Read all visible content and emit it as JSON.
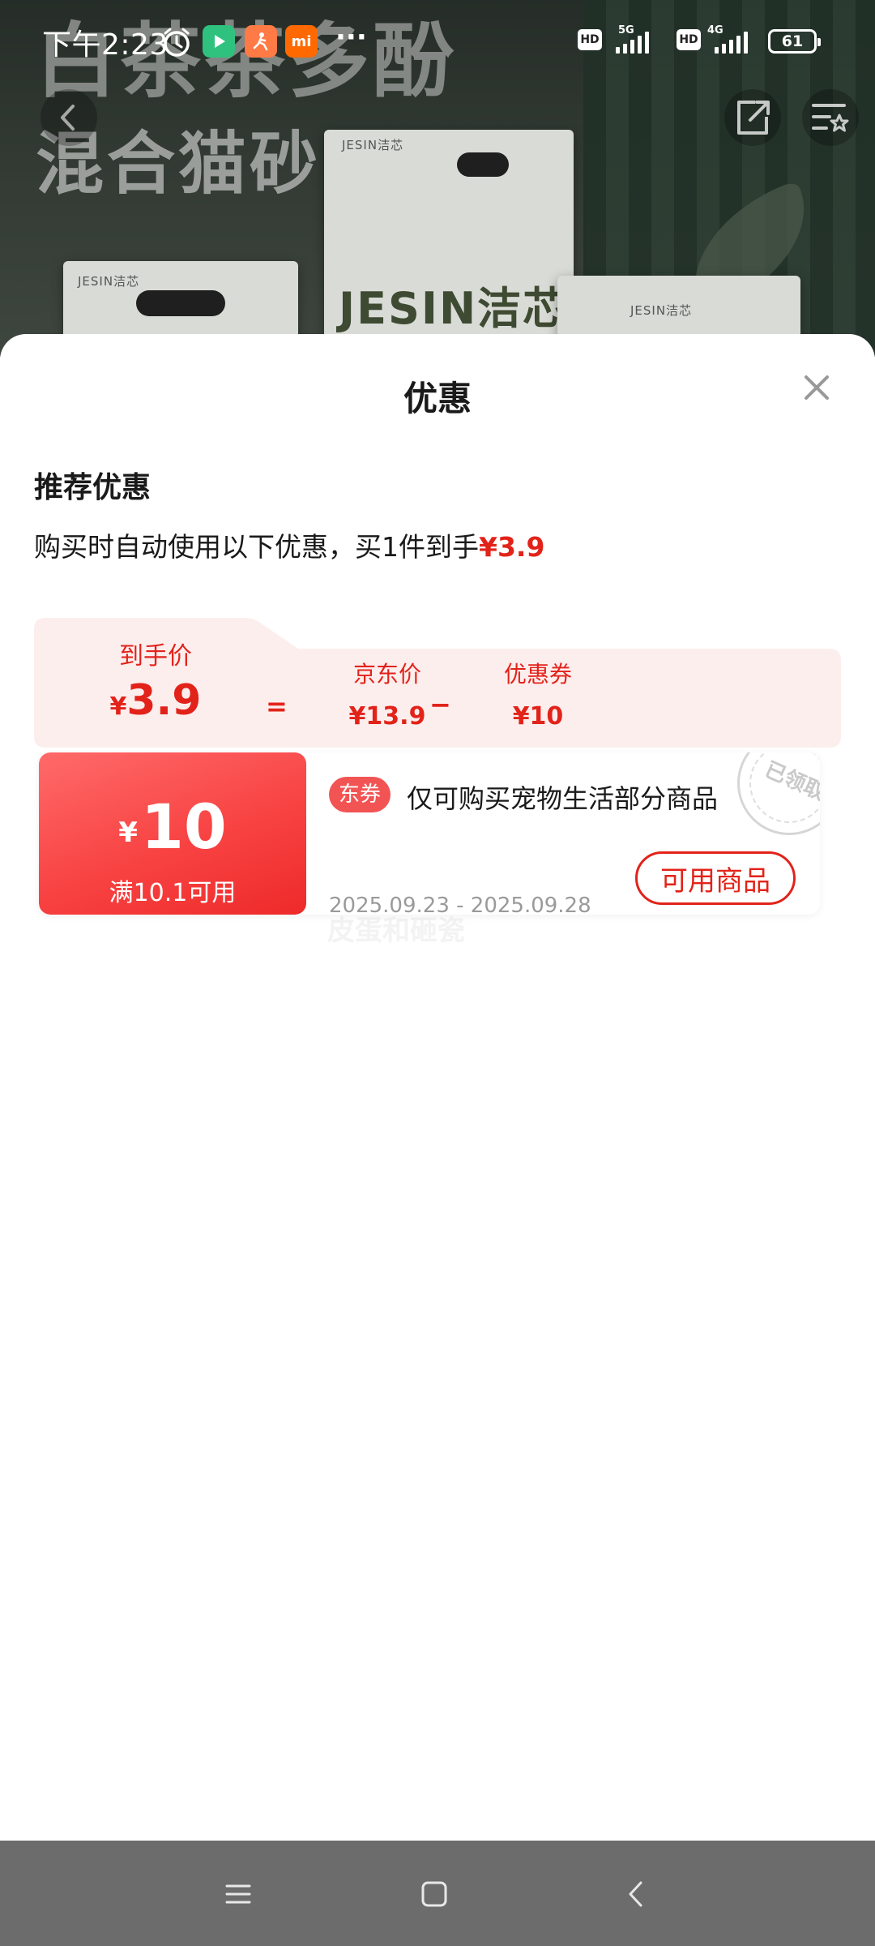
{
  "status_bar": {
    "time": "下午2:23",
    "network_1": "5G",
    "network_2": "4G",
    "hd_label": "HD",
    "battery": "61",
    "mi_label": "mi",
    "more_label": "···"
  },
  "banner": {
    "headline": "白茶茶多酚",
    "subline": "混合猫砂",
    "brand_small": "JESIN洁芯",
    "brand_big": "JESIN洁芯"
  },
  "sheet": {
    "title": "优惠",
    "section_heading": "推荐优惠",
    "desc_prefix": "购买时自动使用以下优惠，买1件到手",
    "desc_price": "¥3.9"
  },
  "price_breakdown": {
    "final_label": "到手价",
    "final_currency": "¥",
    "final_value": "3.9",
    "eq": "=",
    "jd_label": "京东价",
    "jd_value": "¥13.9",
    "minus": "−",
    "coupon_label": "优惠券",
    "coupon_value": "¥10"
  },
  "coupon": {
    "currency": "¥",
    "amount": "10",
    "condition": "满10.1可用",
    "tag": "东券",
    "description": "仅可购买宠物生活部分商品",
    "date_range": "2025.09.23 - 2025.09.28",
    "action": "可用商品",
    "stamp": "已领取"
  },
  "background_ghost_text": "皮蛋和砸瓷",
  "colors": {
    "accent_red": "#e2231a",
    "coupon_gradient_start": "#ff6a6a",
    "coupon_gradient_end": "#ee2a2a",
    "price_card_bg": "#fdeeee",
    "nav_bar_bg": "#6c6c6c"
  }
}
